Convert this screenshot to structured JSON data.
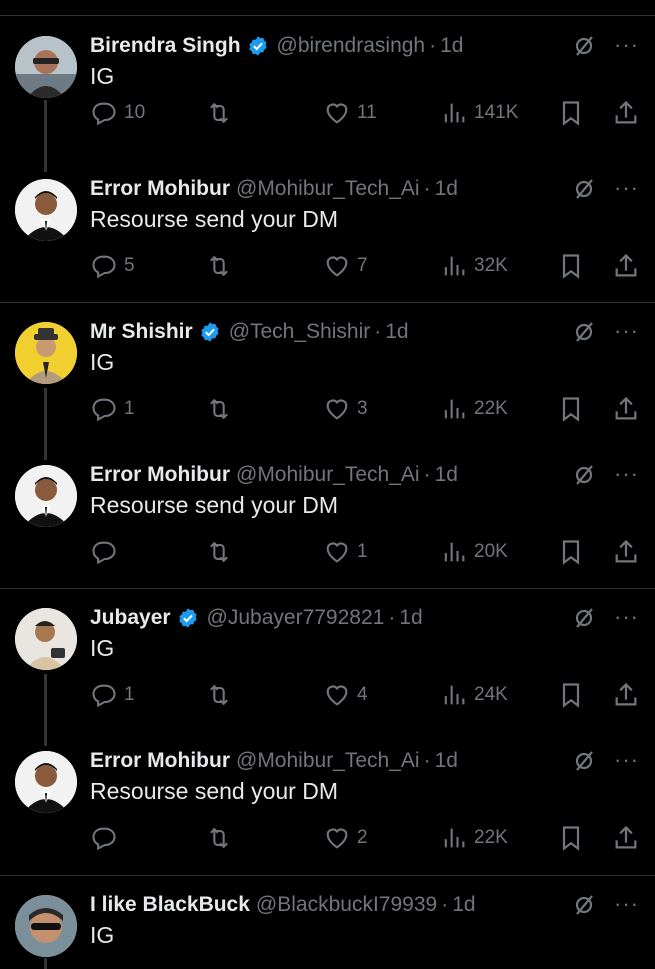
{
  "posts": [
    {
      "name": "Birendra Singh",
      "verified": true,
      "handle": "@birendrasingh",
      "time": "1d",
      "text": "IG",
      "replies": "10",
      "likes": "11",
      "views": "141K",
      "avatar": "avatar-birendra"
    },
    {
      "name": "Error Mohibur",
      "verified": false,
      "handle": "@Mohibur_Tech_Ai",
      "time": "1d",
      "text": "Resourse send your DM",
      "replies": "5",
      "likes": "7",
      "views": "32K",
      "avatar": "avatar-mohibur"
    },
    {
      "name": "Mr Shishir",
      "verified": true,
      "handle": "@Tech_Shishir",
      "time": "1d",
      "text": "IG",
      "replies": "1",
      "likes": "3",
      "views": "22K",
      "avatar": "avatar-shishir"
    },
    {
      "name": "Error Mohibur",
      "verified": false,
      "handle": "@Mohibur_Tech_Ai",
      "time": "1d",
      "text": "Resourse send your DM",
      "replies": "",
      "likes": "1",
      "views": "20K",
      "avatar": "avatar-mohibur"
    },
    {
      "name": "Jubayer",
      "verified": true,
      "handle": "@Jubayer7792821",
      "time": "1d",
      "text": "IG",
      "replies": "1",
      "likes": "4",
      "views": "24K",
      "avatar": "avatar-jubayer"
    },
    {
      "name": "Error Mohibur",
      "verified": false,
      "handle": "@Mohibur_Tech_Ai",
      "time": "1d",
      "text": "Resourse send your DM",
      "replies": "",
      "likes": "2",
      "views": "22K",
      "avatar": "avatar-mohibur"
    },
    {
      "name": "I like BlackBuck",
      "verified": false,
      "handle": "@BlackbuckI79939",
      "time": "1d",
      "text": "IG",
      "avatar": "avatar-blackbuck"
    }
  ],
  "separator": "·",
  "more_label": "···",
  "colors": {
    "background": "#000000",
    "text": "#e7e9ea",
    "muted": "#71767b",
    "verified": "#1d9bf0",
    "divider": "#2f3336"
  }
}
